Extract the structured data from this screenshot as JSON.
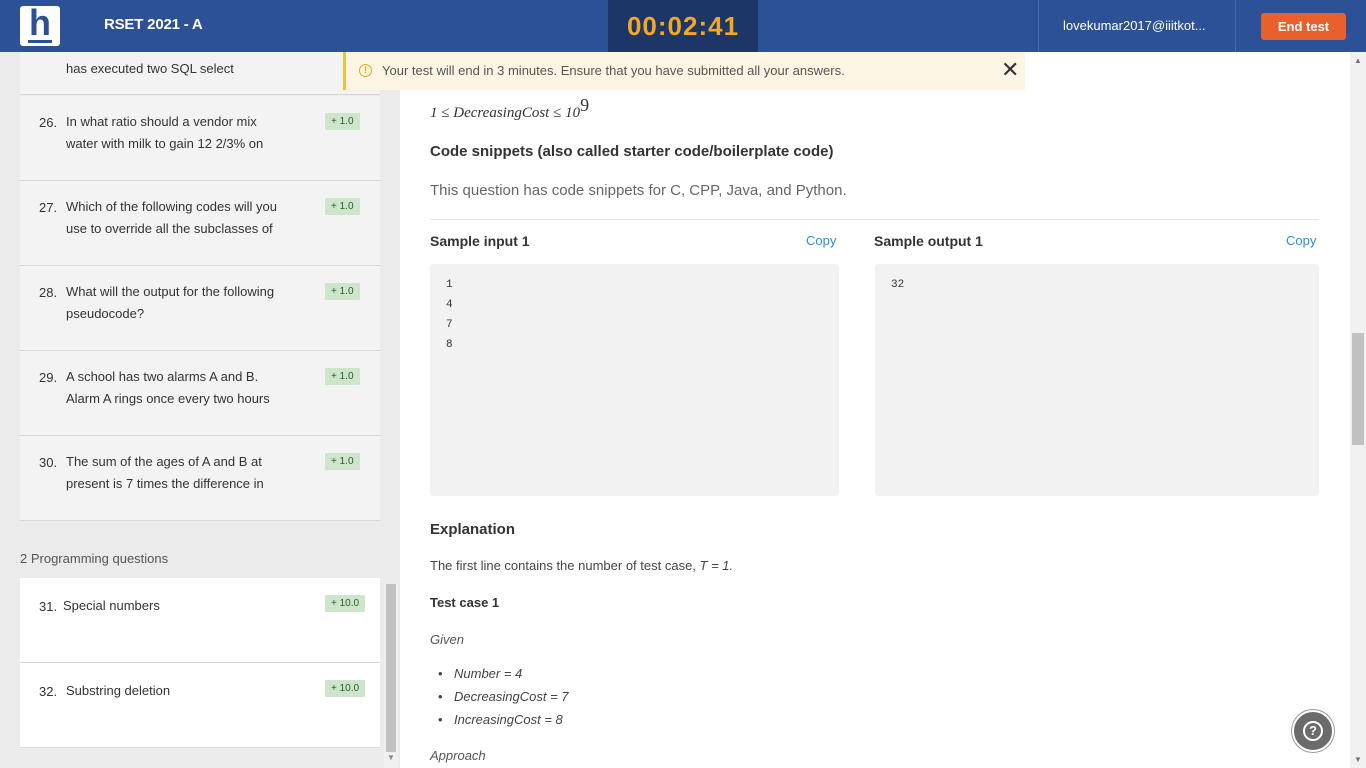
{
  "header": {
    "logo_letter": "h",
    "test_title": "RSET 2021 - A",
    "timer": "00:02:41",
    "user_email": "lovekumar2017@iiitkot...",
    "end_test_label": "End test"
  },
  "banner": {
    "icon": "warning-icon",
    "message": "Your test will end in 3 minutes. Ensure that you have submitted all your answers.",
    "close_glyph": "✕"
  },
  "sidebar": {
    "partial_item_text": "has executed two SQL select",
    "questions": [
      {
        "num": "26.",
        "line1": "In what ratio should a vendor mix",
        "line2": "water with milk to gain 12 2/3% on",
        "score": "+ 1.0"
      },
      {
        "num": "27.",
        "line1": "Which of the following codes will you",
        "line2": "use to override all the subclasses of",
        "score": "+ 1.0"
      },
      {
        "num": "28.",
        "line1": "What will the output for the following",
        "line2": "pseudocode?",
        "score": "+ 1.0"
      },
      {
        "num": "29.",
        "line1": "A school has two alarms A and B.",
        "line2": "Alarm A rings once every two hours",
        "score": "+ 1.0"
      },
      {
        "num": "30.",
        "line1": "The sum of the ages of A and B at",
        "line2": "present is 7 times the difference in",
        "score": "+ 1.0"
      }
    ],
    "section_label": "2 Programming questions",
    "programming": [
      {
        "num": "31.",
        "title": "Special numbers",
        "score": "+ 10.0"
      },
      {
        "num": "32.",
        "title": "Substring deletion",
        "score": "+ 10.0"
      }
    ]
  },
  "main": {
    "constraint": "1 ≤ DecreasingCost ≤ 10",
    "constraint_exp": "9",
    "snippets_heading": "Code snippets (also called starter code/boilerplate code)",
    "snippets_text": "This question has code snippets for C, CPP, Java, and Python.",
    "sample_input_title": "Sample input 1",
    "sample_output_title": "Sample output 1",
    "copy_label": "Copy",
    "sample_input_lines": [
      "1",
      "4",
      "7",
      "8"
    ],
    "sample_output_lines": [
      "32"
    ],
    "explanation_heading": "Explanation",
    "explanation_text": "The first line contains the number of test case,",
    "explanation_var": "T = 1.",
    "test_case_heading": "Test case 1",
    "given_label": "Given",
    "given_items": [
      "Number = 4",
      "DecreasingCost = 7",
      "IncreasingCost = 8"
    ],
    "approach_label": "Approach"
  },
  "help_glyph": "?"
}
